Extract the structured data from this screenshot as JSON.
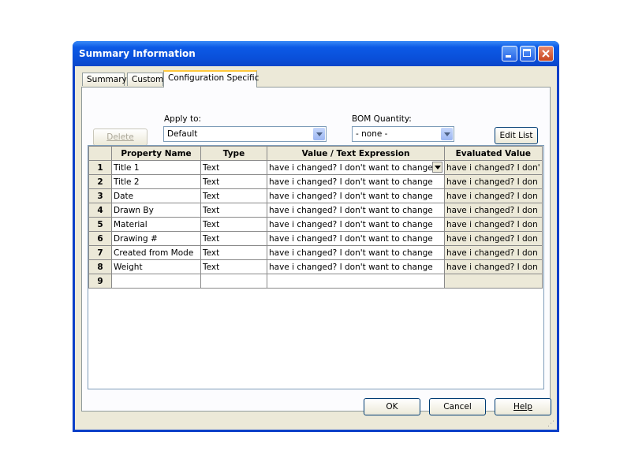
{
  "window": {
    "title": "Summary Information"
  },
  "tabs": [
    {
      "label": "Summary"
    },
    {
      "label": "Custom"
    },
    {
      "label": "Configuration Specific",
      "active": true
    }
  ],
  "toolbar": {
    "delete_label": "Delete",
    "apply_to_label": "Apply to:",
    "apply_to_value": "Default",
    "bom_label": "BOM Quantity:",
    "bom_value": "- none -",
    "edit_list_label": "Edit List"
  },
  "grid": {
    "columns": [
      "Property Name",
      "Type",
      "Value / Text Expression",
      "Evaluated Value"
    ],
    "rows": [
      {
        "num": "1",
        "name": "Title 1",
        "type": "Text",
        "value": "have i changed?  I don't want to change",
        "evaluated": "have i changed?  I don'"
      },
      {
        "num": "2",
        "name": "Title 2",
        "type": "Text",
        "value": "have i changed?  I don't want to change",
        "evaluated": "have i changed?  I don"
      },
      {
        "num": "3",
        "name": "Date",
        "type": "Text",
        "value": "have i changed?  I don't want to change",
        "evaluated": "have i changed?  I don"
      },
      {
        "num": "4",
        "name": "Drawn By",
        "type": "Text",
        "value": "have i changed?  I don't want to change",
        "evaluated": "have i changed?  I don"
      },
      {
        "num": "5",
        "name": "Material",
        "type": "Text",
        "value": "have i changed?  I don't want to change",
        "evaluated": "have i changed?  I don"
      },
      {
        "num": "6",
        "name": "Drawing #",
        "type": "Text",
        "value": "have i changed?  I don't want to change",
        "evaluated": "have i changed?  I don"
      },
      {
        "num": "7",
        "name": "Created from Mode",
        "type": "Text",
        "value": "have i changed?  I don't want to change",
        "evaluated": "have i changed?  I don"
      },
      {
        "num": "8",
        "name": "Weight",
        "type": "Text",
        "value": "have i changed?  I don't want to change",
        "evaluated": "have i changed?  I don"
      },
      {
        "num": "9",
        "name": "",
        "type": "",
        "value": "",
        "evaluated": ""
      }
    ]
  },
  "footer": {
    "ok_label": "OK",
    "cancel_label": "Cancel",
    "help_label": "Help"
  }
}
